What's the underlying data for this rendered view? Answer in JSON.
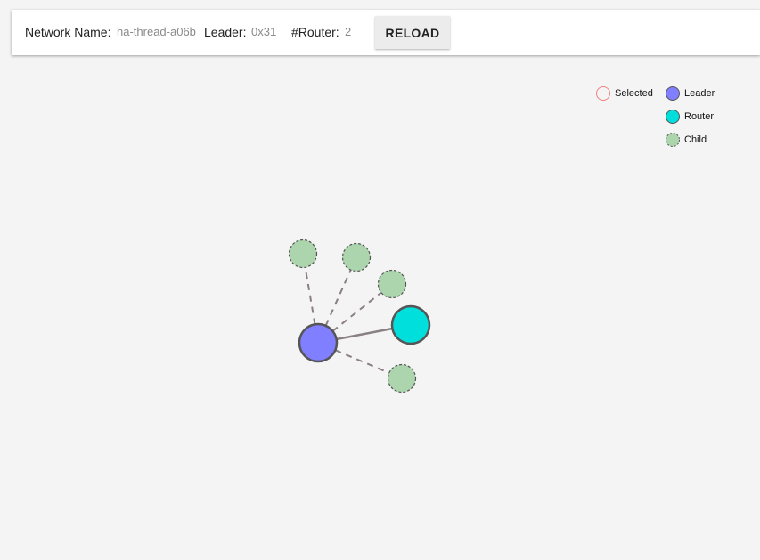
{
  "toolbar": {
    "network_name_label": "Network Name:",
    "network_name_value": "ha-thread-a06b",
    "leader_label": "Leader:",
    "leader_value": "0x31",
    "router_count_label": "#Router:",
    "router_count_value": "2",
    "reload_label": "RELOAD"
  },
  "legend": {
    "selected_label": "Selected",
    "leader_label": "Leader",
    "router_label": "Router",
    "child_label": "Child"
  },
  "colors": {
    "leader": "#7f7fff",
    "router": "#00dfdc",
    "child": "#acd5ad",
    "selected_outline": "#f08080",
    "node_stroke": "#555555",
    "link": "#8a7f82",
    "background": "#f4f4f4"
  },
  "graph": {
    "nodes": [
      {
        "id": "leader",
        "role": "leader"
      },
      {
        "id": "router",
        "role": "router"
      },
      {
        "id": "child-1",
        "role": "child"
      },
      {
        "id": "child-2",
        "role": "child"
      },
      {
        "id": "child-3",
        "role": "child"
      },
      {
        "id": "child-4",
        "role": "child"
      }
    ],
    "links": [
      {
        "source": "leader",
        "target": "router",
        "style": "solid"
      },
      {
        "source": "leader",
        "target": "child-1",
        "style": "dashed"
      },
      {
        "source": "leader",
        "target": "child-2",
        "style": "dashed"
      },
      {
        "source": "leader",
        "target": "child-3",
        "style": "dashed"
      },
      {
        "source": "leader",
        "target": "child-4",
        "style": "dashed"
      }
    ]
  }
}
